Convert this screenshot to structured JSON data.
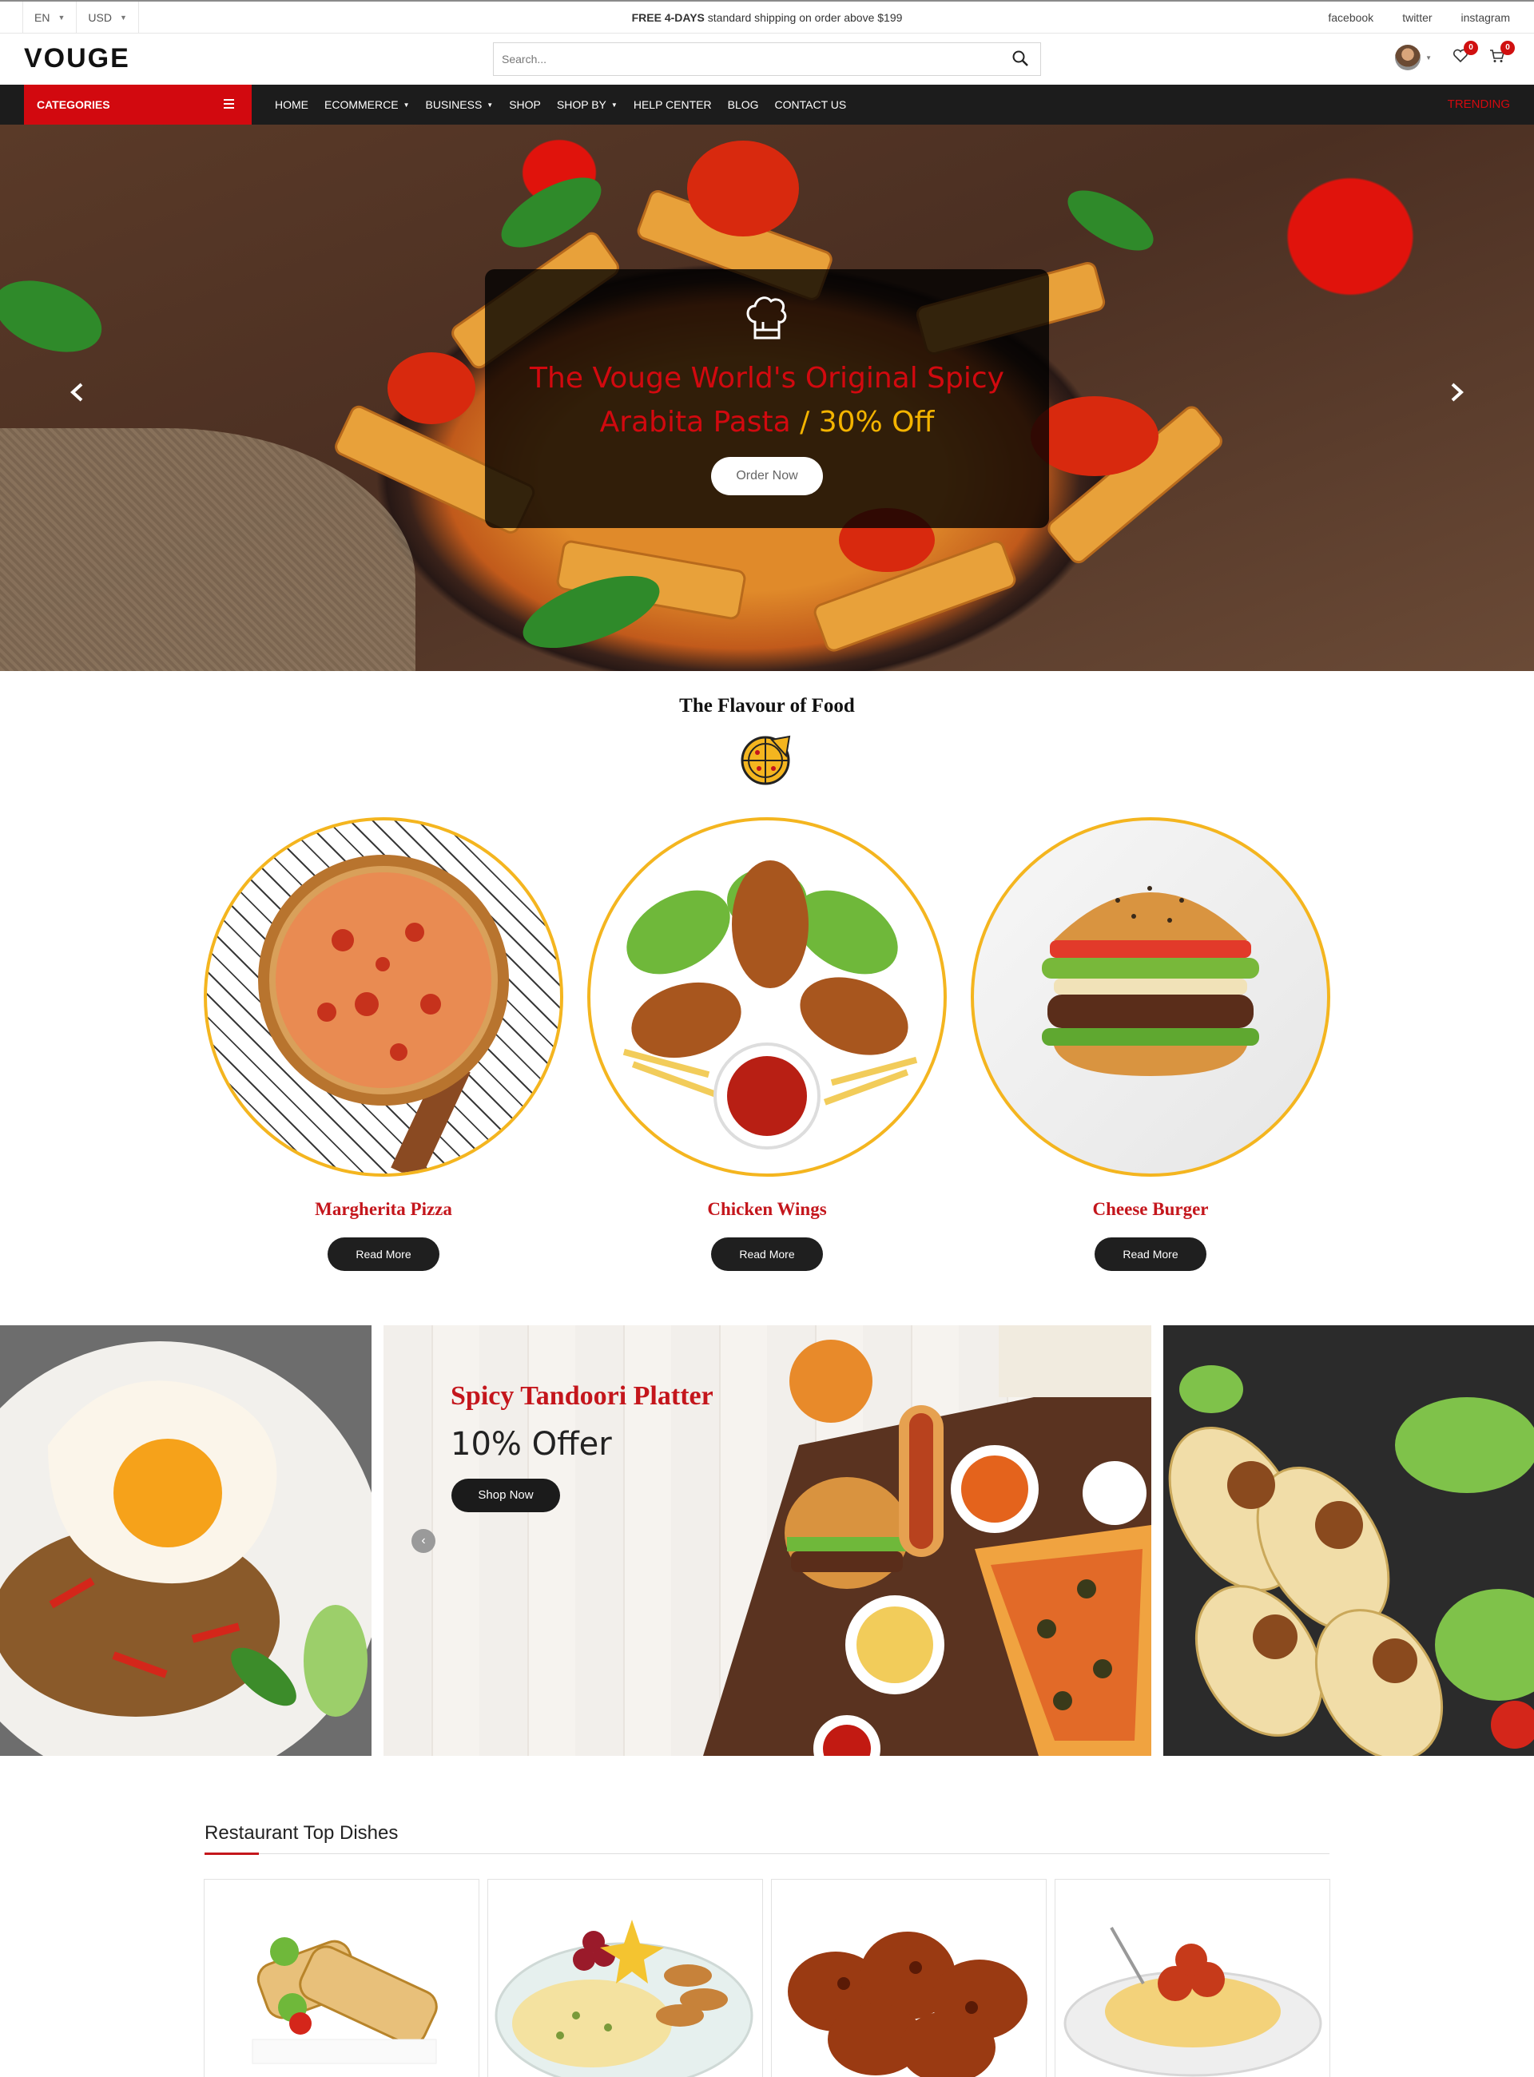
{
  "topbar": {
    "language": "EN",
    "currency": "USD",
    "shipping_bold": "FREE 4-DAYS",
    "shipping_rest": " standard shipping on order above $199",
    "social": [
      "facebook",
      "twitter",
      "instagram"
    ]
  },
  "header": {
    "logo": "VOUGE",
    "search_placeholder": "Search...",
    "wishlist_count": "0",
    "cart_count": "0"
  },
  "nav": {
    "categories_label": "CATEGORIES",
    "items": [
      "HOME",
      "ECOMMERCE",
      "BUSINESS",
      "SHOP",
      "SHOP BY",
      "HELP CENTER",
      "BLOG",
      "CONTACT US"
    ],
    "trending": "TRENDING"
  },
  "hero": {
    "line1": "The Vouge World's Original Spicy",
    "line2": "Arabita Pasta",
    "offer": "/ 30% Off",
    "button": "Order Now"
  },
  "flavour": {
    "title": "The Flavour of Food",
    "dishes": [
      {
        "name": "Margherita Pizza",
        "button": "Read More"
      },
      {
        "name": "Chicken Wings",
        "button": "Read More"
      },
      {
        "name": "Cheese Burger",
        "button": "Read More"
      }
    ]
  },
  "banner": {
    "title": "Spicy Tandoori Platter",
    "offer": "10% Offer",
    "button": "Shop Now"
  },
  "top_dishes": {
    "title": "Restaurant Top Dishes"
  },
  "colors": {
    "accent_red": "#d2090f",
    "offer_yellow": "#f4b400",
    "ring_yellow": "#f4b51f",
    "nav_dark": "#1c1c1c"
  }
}
